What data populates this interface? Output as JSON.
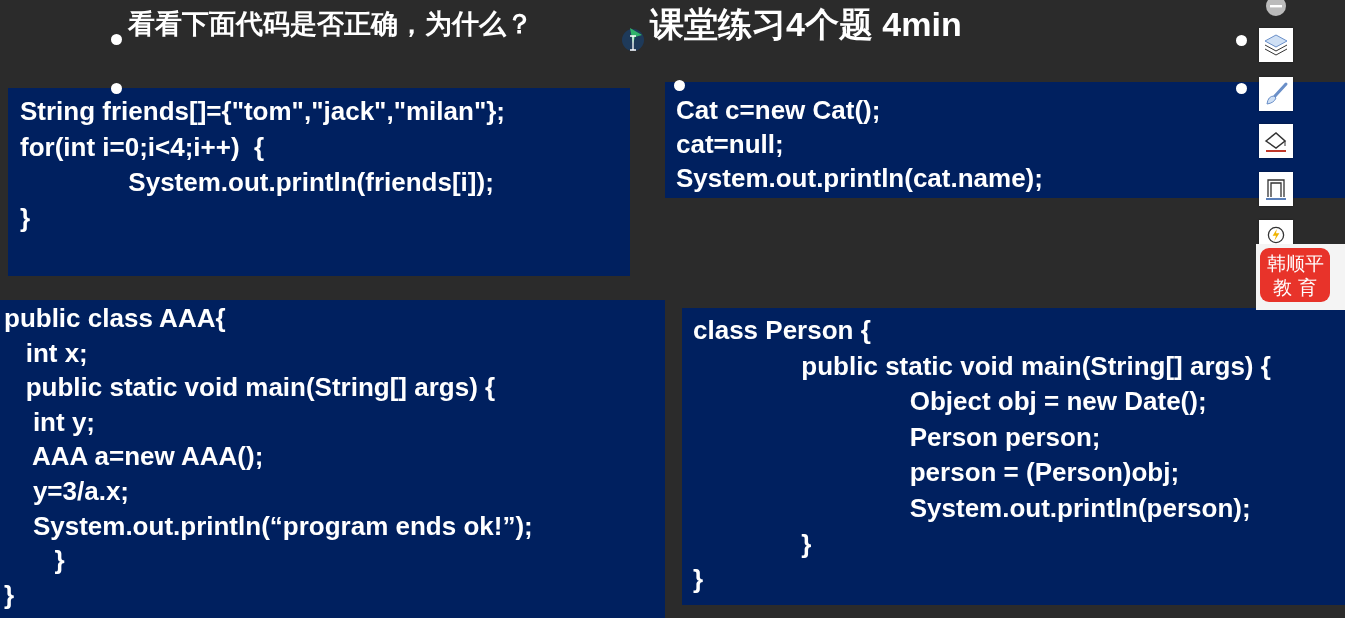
{
  "slide": {
    "heading": "看看下面代码是否正确，为什么？",
    "exercise": "课堂练习4个题 4min",
    "code_blocks": [
      {
        "lines": [
          "String friends[]={\"tom\",\"jack\",\"milan\"};",
          "for(int i=0;i<4;i++)  {",
          "               System.out.println(friends[i]);",
          "}"
        ]
      },
      {
        "lines": [
          "Cat c=new Cat();",
          "cat=null;",
          "System.out.println(cat.name);"
        ]
      },
      {
        "lines": [
          "public class AAA{",
          "   int x;",
          "   public static void main(String[] args) {",
          "    int y;",
          "    AAA a=new AAA();",
          "    y=3/a.x;",
          "    System.out.println(“program ends ok!”);",
          "       }",
          "}"
        ]
      },
      {
        "lines": [
          "class Person {",
          "               public static void main(String[] args) {",
          "                              Object obj = new Date();",
          "                              Person person;",
          "                              person = (Person)obj;",
          "                              System.out.println(person);",
          "               }",
          "}"
        ]
      }
    ]
  },
  "logo": {
    "line_1": "韩顺平",
    "line_2": "教 育"
  }
}
